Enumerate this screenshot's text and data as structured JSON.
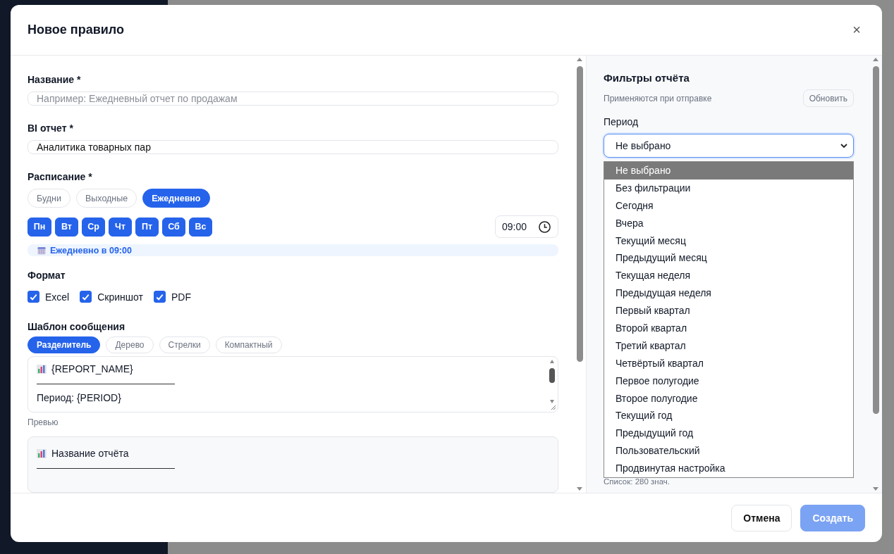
{
  "dialog": {
    "title": "Новое правило",
    "close": "×"
  },
  "form": {
    "name": {
      "label": "Название *",
      "placeholder": "Например: Ежедневный отчет по продажам"
    },
    "report": {
      "label": "BI отчет *",
      "value": "Аналитика товарных пар"
    },
    "schedule": {
      "label": "Расписание *",
      "presets": [
        {
          "label": "Будни",
          "selected": false
        },
        {
          "label": "Выходные",
          "selected": false
        },
        {
          "label": "Ежедневно",
          "selected": true
        }
      ],
      "days": [
        {
          "label": "Пн",
          "selected": true
        },
        {
          "label": "Вт",
          "selected": true
        },
        {
          "label": "Ср",
          "selected": true
        },
        {
          "label": "Чт",
          "selected": true
        },
        {
          "label": "Пт",
          "selected": true
        },
        {
          "label": "Сб",
          "selected": true
        },
        {
          "label": "Вс",
          "selected": true
        }
      ],
      "time": "09:00",
      "summary": "Ежедневно в 09:00"
    },
    "format": {
      "label": "Формат",
      "options": [
        {
          "label": "Excel",
          "checked": true
        },
        {
          "label": "Скриншот",
          "checked": true
        },
        {
          "label": "PDF",
          "checked": true
        }
      ]
    },
    "template": {
      "label": "Шаблон сообщения",
      "styles": [
        {
          "label": "Разделитель",
          "selected": true
        },
        {
          "label": "Дерево",
          "selected": false
        },
        {
          "label": "Стрелки",
          "selected": false
        },
        {
          "label": "Компактный",
          "selected": false
        }
      ],
      "lines": [
        {
          "kind": "title",
          "text": "{REPORT_NAME}"
        },
        {
          "kind": "rule"
        },
        {
          "kind": "text",
          "text": "Период: {PERIOD}"
        }
      ],
      "preview_label": "Превью",
      "preview_lines": [
        {
          "kind": "title",
          "text": "Название отчёта"
        },
        {
          "kind": "rule"
        }
      ]
    }
  },
  "filters": {
    "title": "Фильтры отчёта",
    "hint": "Применяются при отправке",
    "refresh": "Обновить",
    "period": {
      "label": "Период",
      "value": "Не выбрано",
      "expanded": true,
      "options": [
        {
          "label": "Не выбрано",
          "selected": true
        },
        {
          "label": "Без фильтрации",
          "selected": false
        },
        {
          "label": "Сегодня",
          "selected": false
        },
        {
          "label": "Вчера",
          "selected": false
        },
        {
          "label": "Текущий месяц",
          "selected": false
        },
        {
          "label": "Предыдущий месяц",
          "selected": false
        },
        {
          "label": "Текущая неделя",
          "selected": false
        },
        {
          "label": "Предыдущая неделя",
          "selected": false
        },
        {
          "label": "Первый квартал",
          "selected": false
        },
        {
          "label": "Второй квартал",
          "selected": false
        },
        {
          "label": "Третий квартал",
          "selected": false
        },
        {
          "label": "Четвёртый квартал",
          "selected": false
        },
        {
          "label": "Первое полугодие",
          "selected": false
        },
        {
          "label": "Второе полугодие",
          "selected": false
        },
        {
          "label": "Текущий год",
          "selected": false
        },
        {
          "label": "Предыдущий год",
          "selected": false
        },
        {
          "label": "Пользовательский",
          "selected": false
        },
        {
          "label": "Продвинутая настройка",
          "selected": false
        }
      ]
    },
    "count": "Список: 280 знач."
  },
  "buttons": [
    {
      "label": "Отмена",
      "kind": "secondary",
      "disabled": false
    },
    {
      "label": "Создать",
      "kind": "primary",
      "disabled": true
    }
  ]
}
